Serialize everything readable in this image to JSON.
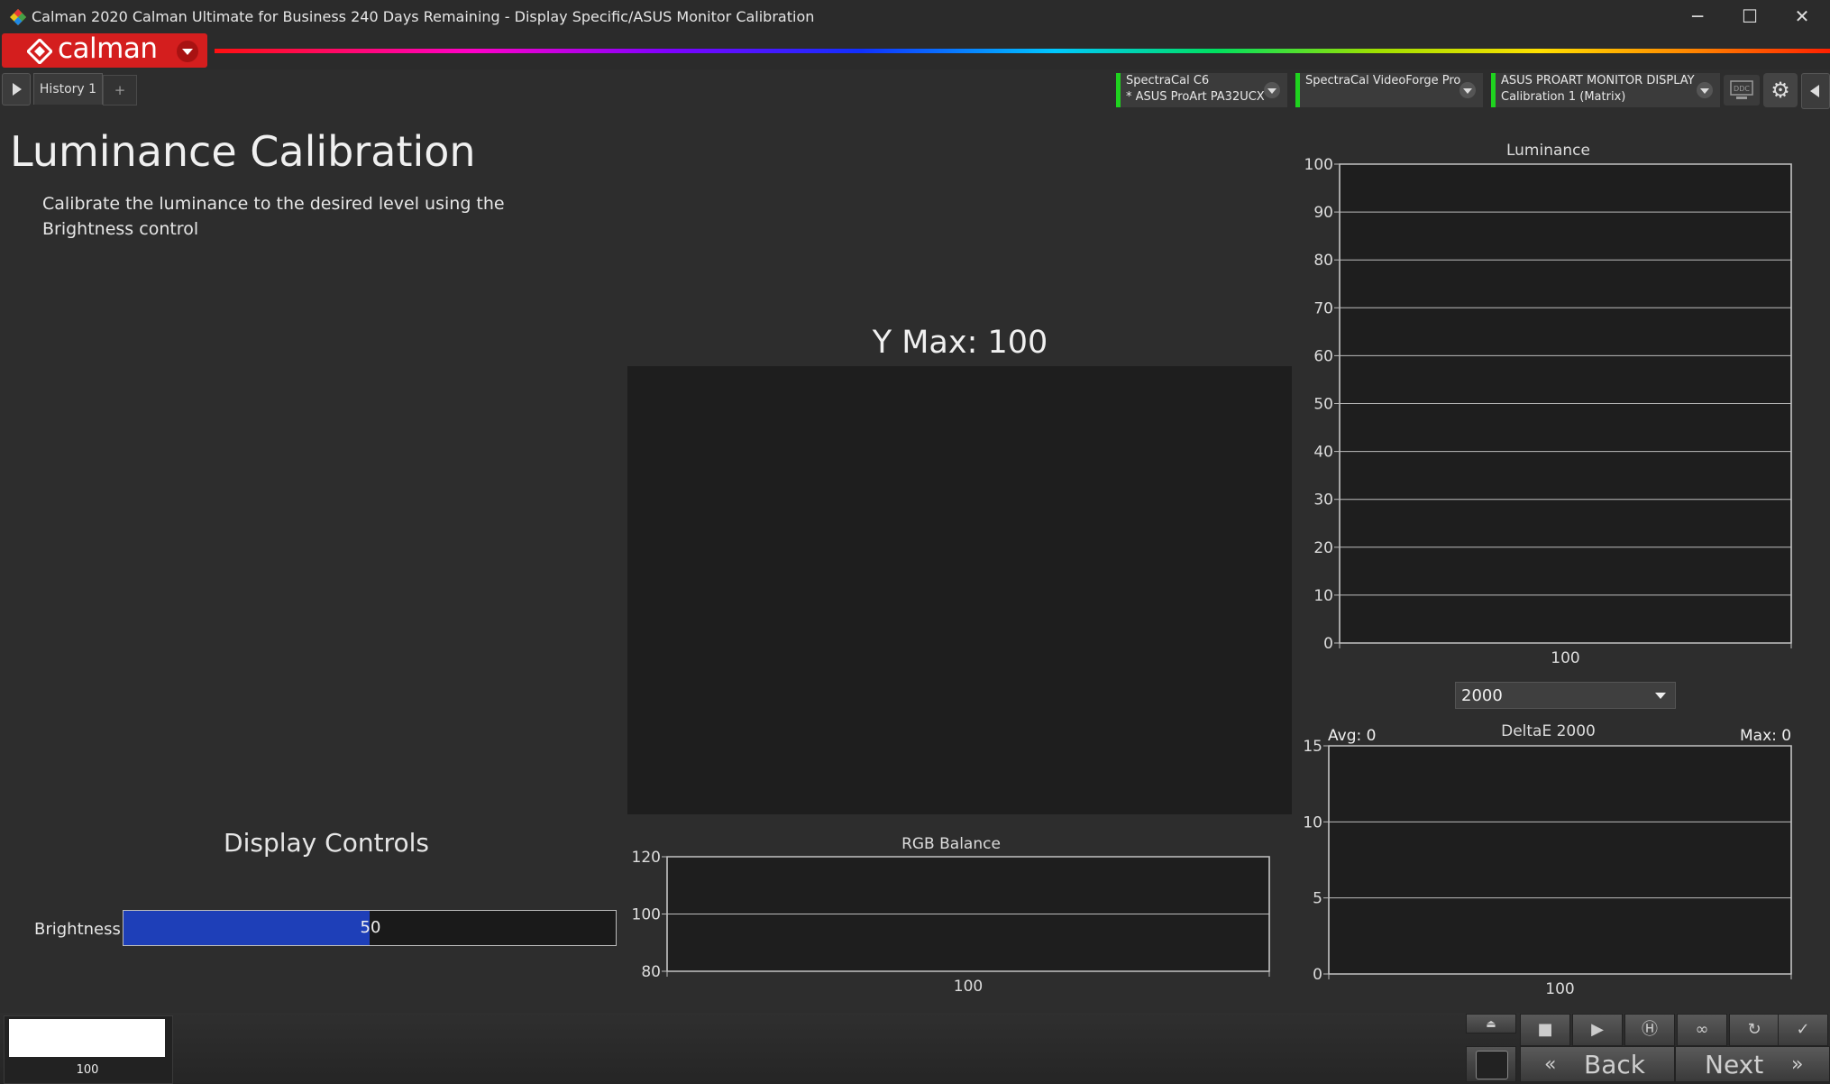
{
  "window": {
    "title": "Calman 2020 Calman Ultimate for Business 240 Days Remaining  -  Display Specific/ASUS Monitor Calibration",
    "minimize": "─",
    "maximize": "☐",
    "close": "✕"
  },
  "brand": {
    "logo_text": "calman"
  },
  "tabs": {
    "history_label": "History 1",
    "add_label": "+"
  },
  "devices": [
    {
      "line1": "SpectraCal C6",
      "line2": "* ASUS ProArt PA32UCX"
    },
    {
      "line1": "SpectraCal VideoForge Pro",
      "line2": ""
    },
    {
      "line1": "ASUS PROART MONITOR DISPLAY",
      "line2": "Calibration 1 (Matrix)"
    }
  ],
  "toolbar": {
    "ddc_label": "DDC",
    "gear_icon": "gear-icon"
  },
  "page": {
    "title": "Luminance Calibration",
    "description": "Calibrate the luminance to the desired level using the Brightness control",
    "ymax": "Y Max: 100"
  },
  "display_controls": {
    "title": "Display Controls",
    "brightness_label": "Brightness",
    "brightness_value": "50",
    "brightness_fraction": 0.5,
    "brightness_fill_color": "#1e3fb8"
  },
  "deltae": {
    "dropdown_value": "2000",
    "avg_label": "Avg: 0",
    "max_label": "Max: 0"
  },
  "chart_data": [
    {
      "type": "bar",
      "title": "Luminance",
      "categories": [
        "100"
      ],
      "values": [],
      "ylim": [
        0,
        100
      ],
      "yticks": [
        0,
        10,
        20,
        30,
        40,
        50,
        60,
        70,
        80,
        90,
        100
      ],
      "grid": true
    },
    {
      "type": "bar",
      "title": "RGB Balance",
      "categories": [
        "100"
      ],
      "values": [],
      "ylim": [
        80,
        120
      ],
      "yticks": [
        80,
        100,
        120
      ],
      "grid": true
    },
    {
      "type": "bar",
      "title": "DeltaE 2000",
      "categories": [
        "100"
      ],
      "values": [],
      "ylim": [
        0,
        15
      ],
      "yticks": [
        0,
        5,
        10,
        15
      ],
      "grid": true
    }
  ],
  "bottom": {
    "swatch_label": "100",
    "swatch_color": "#ffffff",
    "back_label": "Back",
    "next_label": "Next"
  }
}
